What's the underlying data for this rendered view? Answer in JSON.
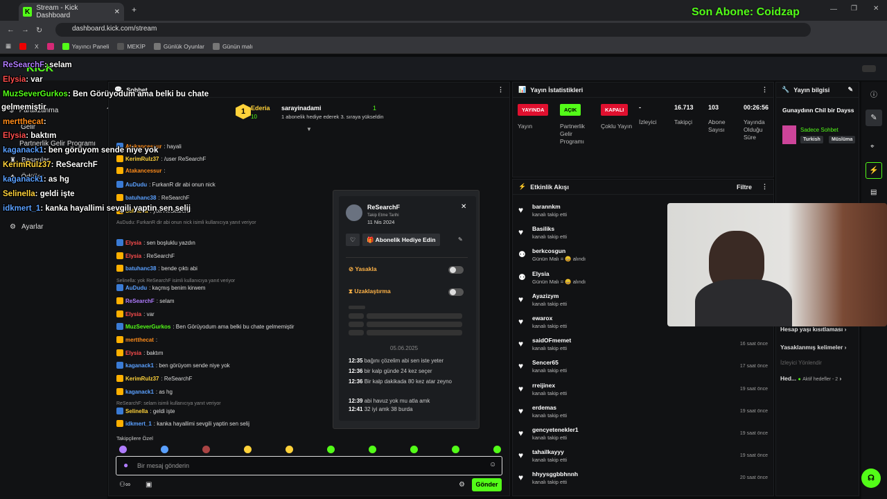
{
  "browser": {
    "tab_title": "Stream - Kick Dashboard",
    "url": "dashboard.kick.com/stream",
    "bookmarks": [
      "Yayıncı Paneli",
      "MEKİP",
      "Günlük Oyunlar",
      "Günün malı"
    ]
  },
  "overlay": {
    "last_sub": "Son Abone: Coidzap",
    "messages": [
      {
        "user": "ReSearchF",
        "text": ": selam",
        "color": "#b07cff"
      },
      {
        "user": "Elysia",
        "text": ": var",
        "color": "#ff4d4d"
      },
      {
        "user": "MuzSeverGurkos",
        "text": ": Ben Görüyodum ama belki bu chate",
        "color": "#53fc18"
      },
      {
        "user": "",
        "text": "gelmemiştir",
        "color": "#fff"
      },
      {
        "user": "mertthecat",
        "text": ":",
        "color": "#ff8c1a"
      },
      {
        "user": "Elysia",
        "text": ": baktım",
        "color": "#ff4d4d"
      },
      {
        "user": "kaganack1",
        "text": ": ben görüyom sende niye yok",
        "color": "#5aa0ff"
      },
      {
        "user": "KerimRulz37",
        "text": ": ReSearchF",
        "color": "#ffd23a"
      },
      {
        "user": "kaganack1",
        "text": ": as hg",
        "color": "#5aa0ff"
      },
      {
        "user": "Selinella",
        "text": ": geldi işte",
        "color": "#ffd23a"
      },
      {
        "user": "idkmert_1",
        "text": ": kanka hayallimi sevgili yaptin sen selij",
        "color": "#5aa0ff"
      }
    ]
  },
  "sidebar": {
    "items": [
      "Paraazanma",
      "Gelir",
      "Partnerlik Gelir Programı",
      "Başarılar",
      "Ödüller",
      "Ayarlar"
    ]
  },
  "chat": {
    "title": "Sohbet",
    "leader_name": "Ederia",
    "leader_count": "10",
    "gifter": "sarayinadami",
    "gift_count": "1",
    "gift_text": "1 abonelik hediye ederek 3. sıraya yükseldin",
    "lines": [
      {
        "user": "Atakancessur",
        "text": ": hayali",
        "color": "#ff8c1a"
      },
      {
        "user": "KerimRulz37",
        "text": ": /user ReSearchF",
        "color": "#ffd23a"
      },
      {
        "user": "Atakancessur",
        "text": ":",
        "color": "#ff8c1a"
      },
      {
        "user": "AuDudu",
        "text": ": FurkanR dir abi onun nick",
        "color": "#5aa0ff"
      },
      {
        "user": "batuhanc38",
        "text": ": ReSearchF",
        "color": "#5aa0ff"
      },
      {
        "user": "Selinella",
        "text": ": yok ReSearchF",
        "color": "#ffd23a"
      },
      {
        "user": "Elysia",
        "text": ": sen boşluklu yazdın",
        "color": "#ff4d4d"
      },
      {
        "user": "Elysia",
        "text": ": ReSearchF",
        "color": "#ff4d4d"
      },
      {
        "user": "batuhanc38",
        "text": ": bende çıktı abi",
        "color": "#5aa0ff"
      },
      {
        "user": "AuDudu",
        "text": ": kaçmış benim kirwem",
        "color": "#5aa0ff"
      },
      {
        "user": "ReSearchF",
        "text": ": selam",
        "color": "#b07cff"
      },
      {
        "user": "Elysia",
        "text": ": var",
        "color": "#ff4d4d"
      },
      {
        "user": "MuzSeverGurkos",
        "text": ": Ben Görüyodum ama belki bu chate gelmemiştir",
        "color": "#53fc18"
      },
      {
        "user": "mertthecat",
        "text": ":",
        "color": "#ff8c1a"
      },
      {
        "user": "Elysia",
        "text": ": baktım",
        "color": "#ff4d4d"
      },
      {
        "user": "kaganack1",
        "text": ": ben görüyom sende niye yok",
        "color": "#5aa0ff"
      },
      {
        "user": "KerimRulz37",
        "text": ": ReSearchF",
        "color": "#ffd23a"
      },
      {
        "user": "kaganack1",
        "text": ": as hg",
        "color": "#5aa0ff"
      },
      {
        "user": "Selinella",
        "text": ": geldi işte",
        "color": "#ffd23a"
      },
      {
        "user": "idkmert_1",
        "text": ": kanka hayallimi sevgili yaptin sen selij",
        "color": "#5aa0ff"
      }
    ],
    "replies": [
      "AuDudu: FurkanR dir abi onun nick isimli kullanıcıya yanıt veriyor",
      "Selinella: yok ReSearchF isimli kullanıcıya yanıt veriyor",
      "ReSearchF: selam isimli kullanıcıya yanıt veriyor"
    ],
    "followers_only": "Takipçilere Özel",
    "input_placeholder": "Bir mesaj gönderin",
    "send_label": "Gönder"
  },
  "user_card": {
    "name": "ReSearchF",
    "follow_date_label": "Takip Etme Tarihi",
    "follow_date": "11 Nis 2024",
    "gift_button": "Abonelik Hediye Edin",
    "ban_label": "Yasakla",
    "timeout_label": "Uzaklaştırma",
    "date": "05.06.2025",
    "history": [
      {
        "time": "12:35",
        "text": "bağını çözelim abi sen iste yeter"
      },
      {
        "time": "12:36",
        "text": "bir kalp günde 24 kez seçer"
      },
      {
        "time": "12:36",
        "text": "Bir kalp dakikada 80 kez atar zeyno"
      },
      {
        "time": "12:39",
        "text": "abi havuz yok mu atla amk"
      },
      {
        "time": "12:41",
        "text": "32 iyi amk 38 burda"
      }
    ]
  },
  "stats": {
    "title": "Yayın İstatistikleri",
    "items": [
      {
        "pill": "YAYINDA",
        "pill_color": "#e0102f",
        "label": "Yayın"
      },
      {
        "pill": "AÇIK",
        "pill_color": "#53fc18",
        "label": "Partnerlik Gelir Programı"
      },
      {
        "pill": "KAPALI",
        "pill_color": "#e0102f",
        "label": "Çoklu Yayın"
      },
      {
        "value": "-",
        "label": "İzleyici"
      },
      {
        "value": "16.713",
        "label": "Takipçi"
      },
      {
        "value": "103",
        "label": "Abone Sayısı"
      },
      {
        "value": "00:26:56",
        "label": "Yayında Olduğu Süre"
      }
    ]
  },
  "stream_info": {
    "title": "Yayın bilgisi",
    "stream_title": "Gunaydınn Chil bir Dayss",
    "category": "Sadece Sohbet",
    "tags": [
      "Turkish",
      "Müslüma"
    ]
  },
  "activity": {
    "title": "Etkinlik Akışı",
    "filter": "Filtre",
    "items": [
      {
        "name": "barannkm",
        "sub": "kanalı takip etti",
        "time": ""
      },
      {
        "name": "Basiliks",
        "sub": "kanalı takip etti",
        "time": ""
      },
      {
        "name": "berkcosgun",
        "sub": "Günün Malı = 😀 alındı",
        "time": ""
      },
      {
        "name": "Elysia",
        "sub": "Günün Malı = 😀 alındı",
        "time": ""
      },
      {
        "name": "Ayazizym",
        "sub": "kanalı takip etti",
        "time": ""
      },
      {
        "name": "ewarox",
        "sub": "kanalı takip etti",
        "time": ""
      },
      {
        "name": "saidOFmemet",
        "sub": "kanalı takip etti",
        "time": "16 saat önce"
      },
      {
        "name": "Sencer65",
        "sub": "kanalı takip etti",
        "time": "17 saat önce"
      },
      {
        "name": "rreijinex",
        "sub": "kanalı takip etti",
        "time": "19 saat önce"
      },
      {
        "name": "erdemas",
        "sub": "kanalı takip etti",
        "time": "19 saat önce"
      },
      {
        "name": "gencyetenekler1",
        "sub": "kanalı takip etti",
        "time": "19 saat önce"
      },
      {
        "name": "tahailkayyy",
        "sub": "kanalı takip etti",
        "time": "19 saat önce"
      },
      {
        "name": "hhyysggbbhnnh",
        "sub": "kanalı takip etti",
        "time": "20 saat önce"
      }
    ]
  },
  "settings_links": [
    "Hesap yaşı kısıtlaması",
    "Yasaklanmış kelimeler",
    "İzleyici Yönlendir",
    "Hed...",
    "Aktif hedefler - 2"
  ]
}
